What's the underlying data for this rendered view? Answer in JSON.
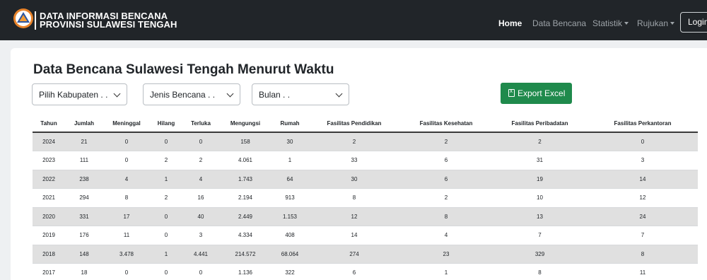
{
  "navbar": {
    "brand_line1": "DATA INFORMASI BENCANA",
    "brand_line2": "PROVINSI SULAWESI TENGAH",
    "logo_icon": "bnpb-logo-icon",
    "items": [
      {
        "label": "Home",
        "active": true
      },
      {
        "label": "Data Bencana",
        "active": false
      },
      {
        "label": "Statistik",
        "active": false,
        "dropdown": true
      },
      {
        "label": "Rujukan",
        "active": false,
        "dropdown": true
      }
    ],
    "login_label": "Login"
  },
  "page": {
    "title": "Data Bencana Sulawesi Tengah Menurut Waktu"
  },
  "filters": {
    "kabupaten": "Pilih Kabupaten . .",
    "jenis": "Jenis Bencana . .",
    "bulan": "Bulan . ."
  },
  "export": {
    "label": "Export Excel",
    "icon": "excel-icon",
    "color": "#1f8a4c"
  },
  "table": {
    "headers": [
      "Tahun",
      "Jumlah",
      "Meninggal",
      "Hilang",
      "Terluka",
      "Mengungsi",
      "Rumah",
      "Fasilitas Pendidikan",
      "Fasilitas Kesehatan",
      "Fasilitas Peribadatan",
      "Fasilitas Perkantoran"
    ],
    "rows": [
      [
        "2024",
        "21",
        "0",
        "0",
        "0",
        "158",
        "30",
        "2",
        "2",
        "2",
        "0"
      ],
      [
        "2023",
        "111",
        "0",
        "2",
        "2",
        "4.061",
        "1",
        "33",
        "6",
        "31",
        "3"
      ],
      [
        "2022",
        "238",
        "4",
        "1",
        "4",
        "1.743",
        "64",
        "30",
        "6",
        "19",
        "14"
      ],
      [
        "2021",
        "294",
        "8",
        "2",
        "16",
        "2.194",
        "913",
        "8",
        "2",
        "10",
        "12"
      ],
      [
        "2020",
        "331",
        "17",
        "0",
        "40",
        "2.449",
        "1.153",
        "12",
        "8",
        "13",
        "24"
      ],
      [
        "2019",
        "176",
        "11",
        "0",
        "3",
        "4.334",
        "408",
        "14",
        "4",
        "7",
        "7"
      ],
      [
        "2018",
        "148",
        "3.478",
        "1",
        "4.441",
        "214.572",
        "68.064",
        "274",
        "23",
        "329",
        "8"
      ],
      [
        "2017",
        "18",
        "0",
        "0",
        "0",
        "1.136",
        "322",
        "6",
        "1",
        "8",
        "11"
      ]
    ]
  }
}
